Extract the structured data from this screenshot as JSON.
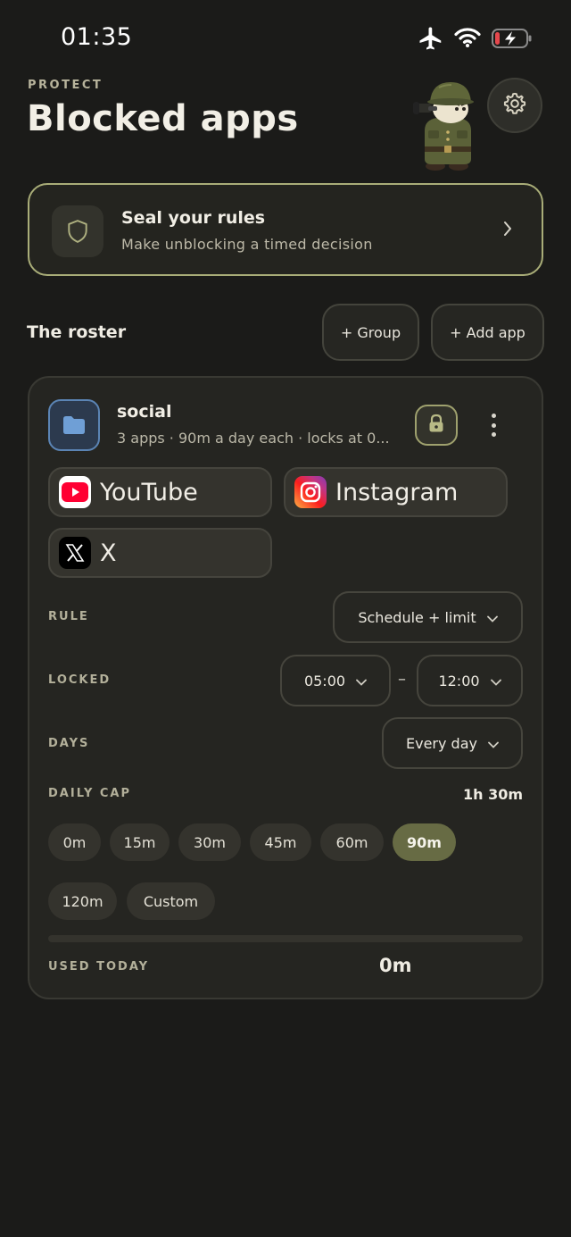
{
  "status_bar": {
    "time": "01:35"
  },
  "header": {
    "eyebrow": "PROTECT",
    "title": "Blocked apps"
  },
  "seal_card": {
    "title": "Seal your rules",
    "subtitle": "Make unblocking a timed decision"
  },
  "roster": {
    "title": "The roster",
    "group_button": "+ Group",
    "add_app_button": "+ Add app"
  },
  "group": {
    "name": "social",
    "summary": "3 apps · 90m a day each · locks at 0...",
    "apps": [
      {
        "name": "YouTube",
        "icon": "youtube-icon"
      },
      {
        "name": "Instagram",
        "icon": "instagram-icon"
      },
      {
        "name": "X",
        "icon": "x-icon"
      }
    ],
    "rule": {
      "label": "RULE",
      "value": "Schedule + limit"
    },
    "locked": {
      "label": "LOCKED",
      "start": "05:00",
      "separator": "–",
      "end": "12:00"
    },
    "days": {
      "label": "DAYS",
      "value": "Every day"
    },
    "daily_cap": {
      "label": "DAILY CAP",
      "value": "1h 30m",
      "options": [
        "0m",
        "15m",
        "30m",
        "45m",
        "60m",
        "90m",
        "120m",
        "Custom"
      ],
      "selected": "90m"
    },
    "used_today": {
      "label": "USED TODAY",
      "value": "0m",
      "fraction": 0
    }
  },
  "colors": {
    "background": "#1b1b19",
    "accent_olive": "#676b44",
    "seal_border": "#a9ad78",
    "folder_blue": "#5b84b4",
    "battery_red": "#e5484d"
  }
}
